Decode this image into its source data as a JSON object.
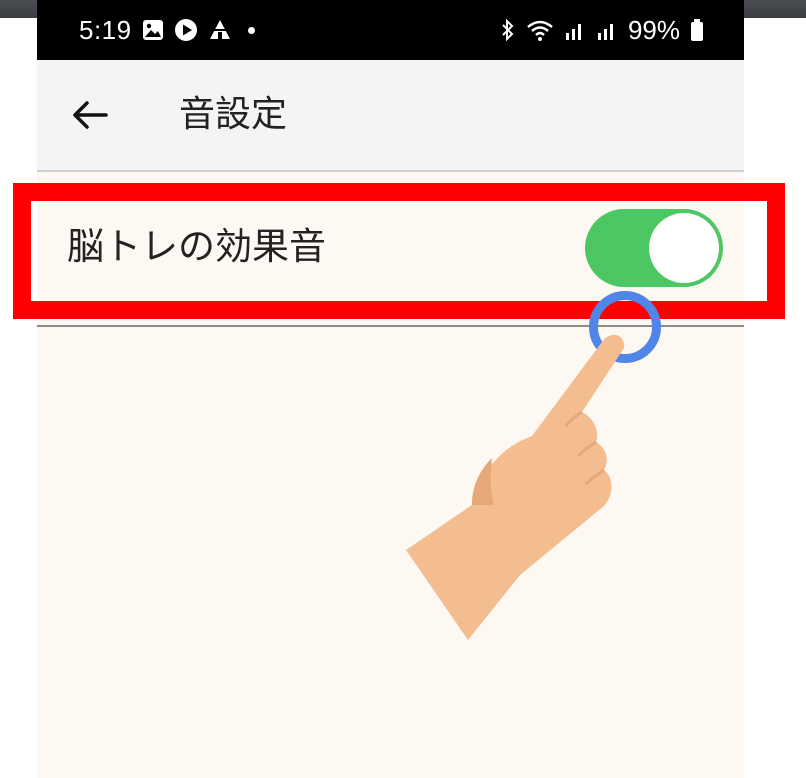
{
  "status_bar": {
    "time": "5:19",
    "battery": "99%",
    "left_icons": [
      "photo-icon",
      "play-store-icon",
      "tent-icon",
      "notification-dot-icon"
    ],
    "right_icons": [
      "bluetooth-icon",
      "wifi-icon",
      "signal-icon",
      "signal-icon",
      "battery-icon"
    ]
  },
  "header": {
    "back_icon": "arrow-left-icon",
    "title": "音設定"
  },
  "settings": {
    "items": [
      {
        "label": "脳トレの効果音",
        "enabled": true
      }
    ]
  },
  "annotation": {
    "highlight_color": "#ff0000",
    "tap_circle_color": "#4f86e8",
    "pointer": "hand-pointer-icon"
  },
  "colors": {
    "toggle_on": "#4cc764",
    "background": "#fdf8f2",
    "header_bg": "#f4f4f4"
  }
}
